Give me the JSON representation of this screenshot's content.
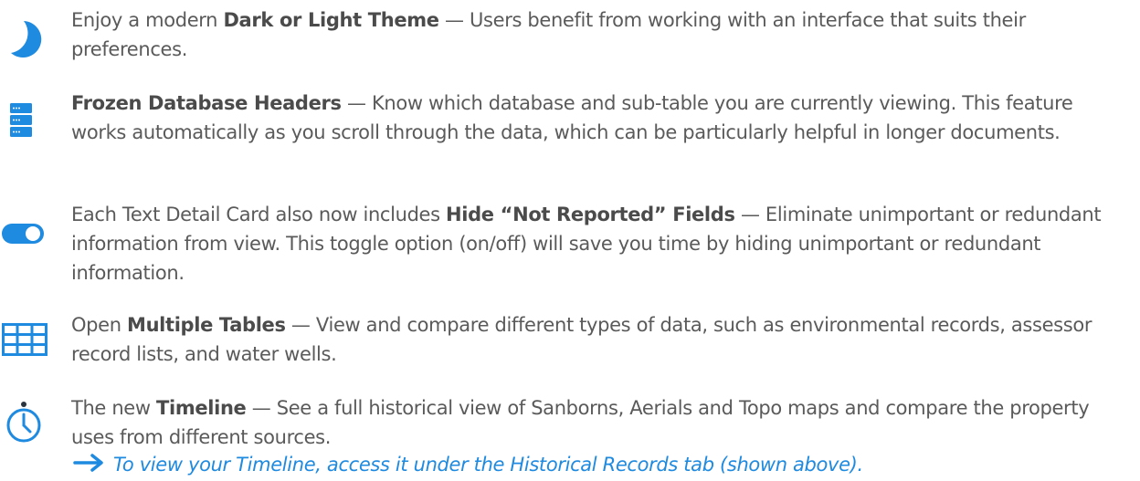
{
  "accent_color": "#1e8ae0",
  "features": [
    {
      "icon": "moon-icon",
      "prefix": "Enjoy a modern ",
      "bold": "Dark or Light Theme",
      "rest": " — Users benefit from working with an interface that suits their preferences."
    },
    {
      "icon": "server-icon",
      "prefix": "",
      "bold": "Frozen Database Headers",
      "rest": " — Know which database and sub-table you are currently viewing. This feature works automatically as you scroll through the data, which can be particularly helpful in longer documents."
    },
    {
      "icon": "toggle-icon",
      "prefix": "Each Text Detail Card also now includes ",
      "bold": "Hide “Not Reported” Fields",
      "rest": " — Eliminate unimportant or redundant information from view. This toggle option (on/off) will save you time by hiding unimportant or redundant information."
    },
    {
      "icon": "table-icon",
      "prefix": "Open ",
      "bold": "Multiple Tables",
      "rest": " — View and compare different types of data, such as environmental records, assessor record lists, and water wells."
    },
    {
      "icon": "clock-icon",
      "prefix": "The new ",
      "bold": "Timeline",
      "rest": " — See a full historical view of Sanborns, Aerials and Topo maps and compare the property uses from different sources."
    }
  ],
  "note": {
    "icon": "arrow-right-icon",
    "text": "To view your Timeline, access it under the Historical Records tab (shown above)."
  }
}
